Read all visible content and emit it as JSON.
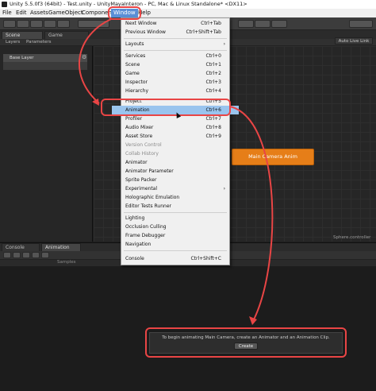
{
  "window": {
    "title": "Unity 5.5.0f3 (64bit) - Test.unity - UnityMayaInteron - PC, Mac & Linux Standalone* <DX11>"
  },
  "menubar": [
    "File",
    "Edit",
    "Assets",
    "GameObject",
    "Component",
    "Window",
    "Help"
  ],
  "window_menu": {
    "items": [
      {
        "label": "Next Window",
        "shortcut": "Ctrl+Tab"
      },
      {
        "label": "Previous Window",
        "shortcut": "Ctrl+Shift+Tab"
      },
      {
        "label": "Layouts",
        "submenu": true
      },
      {
        "label": "Services",
        "shortcut": "Ctrl+0"
      },
      {
        "label": "Scene",
        "shortcut": "Ctrl+1"
      },
      {
        "label": "Game",
        "shortcut": "Ctrl+2"
      },
      {
        "label": "Inspector",
        "shortcut": "Ctrl+3"
      },
      {
        "label": "Hierarchy",
        "shortcut": "Ctrl+4"
      },
      {
        "label": "Project",
        "shortcut": "Ctrl+5"
      },
      {
        "label": "Animation",
        "shortcut": "Ctrl+6",
        "highlighted": true
      },
      {
        "label": "Profiler",
        "shortcut": "Ctrl+7"
      },
      {
        "label": "Audio Mixer",
        "shortcut": "Ctrl+8"
      },
      {
        "label": "Asset Store",
        "shortcut": "Ctrl+9"
      },
      {
        "label": "Version Control",
        "disabled": true
      },
      {
        "label": "Collab History",
        "disabled": true
      },
      {
        "label": "Animator"
      },
      {
        "label": "Animator Parameter"
      },
      {
        "label": "Sprite Packer"
      },
      {
        "label": "Experimental",
        "submenu": true
      },
      {
        "label": "Holographic Emulation"
      },
      {
        "label": "Editor Tests Runner"
      },
      {
        "label": "Lighting"
      },
      {
        "label": "Occlusion Culling"
      },
      {
        "label": "Frame Debugger"
      },
      {
        "label": "Navigation"
      },
      {
        "label": "Console",
        "shortcut": "Ctrl+Shift+C"
      }
    ]
  },
  "top_tabs": [
    "Scene",
    "Game"
  ],
  "animator_tabs": [
    "Layers",
    "Parameters"
  ],
  "layer": {
    "name": "Base Layer"
  },
  "auto_live_link": "Auto Live Link",
  "state_node": "Main Camera Anim",
  "sphere_label": "Sphere.controller",
  "bottom_tabs": [
    "Console",
    "Animation"
  ],
  "samples_label": "Samples",
  "animation_message": {
    "text": "To begin animating Main Camera, create an Animator and an Animation Clip.",
    "button": "Create"
  },
  "colors": {
    "highlight_ring": "#e94545",
    "menu_highlight": "#99c4ee",
    "state_node": "#e67e18"
  }
}
